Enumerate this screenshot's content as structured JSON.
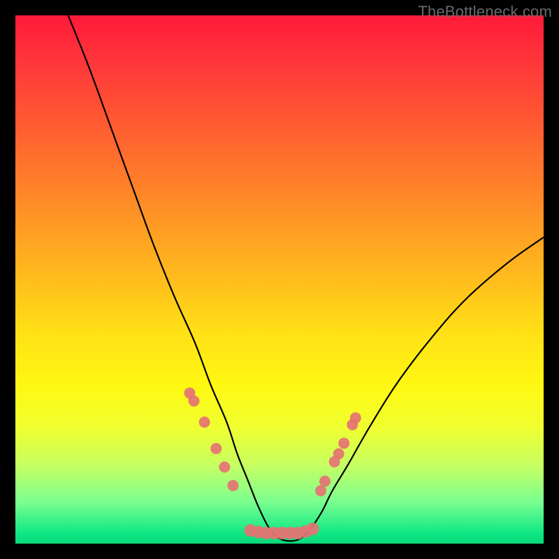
{
  "watermark": "TheBottleneck.com",
  "colors": {
    "frame": "#000000",
    "curve": "#000000",
    "marker": "#e57373",
    "gradient_top": "#ff1a3a",
    "gradient_bottom": "#08d878"
  },
  "chart_data": {
    "type": "line",
    "title": "",
    "xlabel": "",
    "ylabel": "",
    "xlim": [
      0,
      100
    ],
    "ylim": [
      0,
      100
    ],
    "grid": false,
    "legend": false,
    "description": "V-shaped bottleneck curve over a rainbow vertical gradient. Curve minimum near center; salmon markers cluster along the lower branches and flatten at the bottom.",
    "series": [
      {
        "name": "curve",
        "style": "line",
        "x": [
          10,
          14,
          18,
          22,
          26,
          30,
          34,
          37,
          40,
          42,
          44,
          46,
          48,
          50,
          52,
          54,
          56,
          58,
          60,
          63,
          67,
          72,
          78,
          85,
          93,
          100
        ],
        "y": [
          100,
          90,
          79,
          68,
          57,
          47,
          38,
          30,
          23,
          17,
          12,
          7,
          3,
          1,
          0.5,
          1,
          3,
          6,
          10,
          15,
          22,
          30,
          38,
          46,
          53,
          58
        ]
      },
      {
        "name": "markers_left_branch",
        "style": "scatter",
        "x": [
          33.0,
          33.8,
          35.8,
          38.0,
          39.6,
          41.2
        ],
        "y": [
          28.5,
          27.0,
          23.0,
          18.0,
          14.5,
          11.0
        ]
      },
      {
        "name": "markers_right_branch",
        "style": "scatter",
        "x": [
          57.8,
          58.6,
          60.4,
          61.2,
          62.2,
          63.8,
          64.4
        ],
        "y": [
          10.0,
          11.8,
          15.5,
          17.0,
          19.0,
          22.5,
          23.8
        ]
      },
      {
        "name": "markers_flat_bottom",
        "style": "scatter",
        "x": [
          44.5,
          46.0,
          47.5,
          49.0,
          50.5,
          52.0,
          53.5,
          55.0,
          56.3
        ],
        "y": [
          2.5,
          2.2,
          2.0,
          2.0,
          2.0,
          2.0,
          2.0,
          2.3,
          2.8
        ]
      }
    ]
  }
}
